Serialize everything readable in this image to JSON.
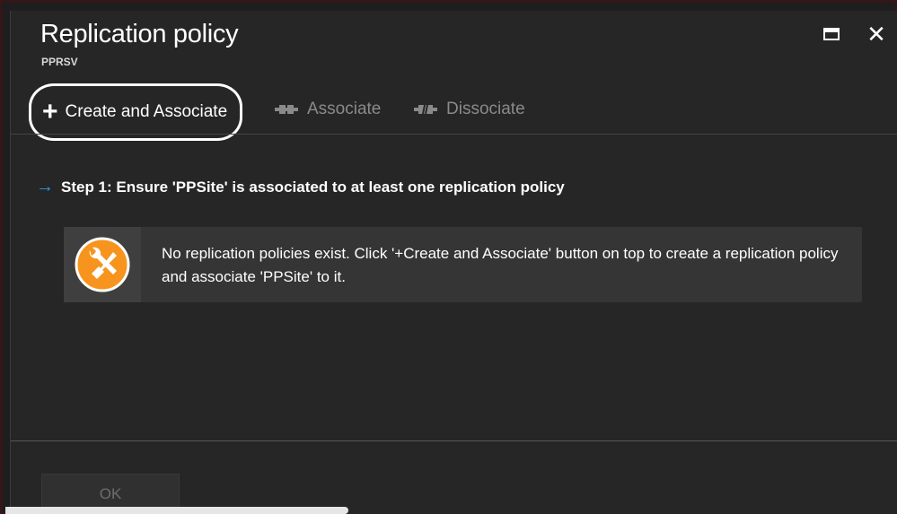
{
  "window": {
    "title": "Replication policy",
    "subtitle": "PPRSV",
    "close_glyph": "✕"
  },
  "toolbar": {
    "create_label": "Create and Associate",
    "associate_label": "Associate",
    "dissociate_label": "Dissociate",
    "plus_glyph": "+"
  },
  "content": {
    "arrow_glyph": "→",
    "step_text": "Step 1: Ensure 'PPSite' is associated to at least one replication policy",
    "notice_text": "No replication policies exist. Click '+Create and Associate' button on top to create a replication policy and associate 'PPSite' to it."
  },
  "footer": {
    "ok_label": "OK"
  },
  "icons": {
    "maximize": "maximize-icon",
    "close": "close-icon",
    "plus": "plus-icon",
    "associate": "associate-icon",
    "dissociate": "dissociate-icon",
    "tools": "tools-icon",
    "arrow": "arrow-right-icon"
  },
  "colors": {
    "background": "#262626",
    "accent_arrow": "#2b9ae4",
    "tools_badge": "#f7941d",
    "disabled_text": "#8a8a8a"
  }
}
